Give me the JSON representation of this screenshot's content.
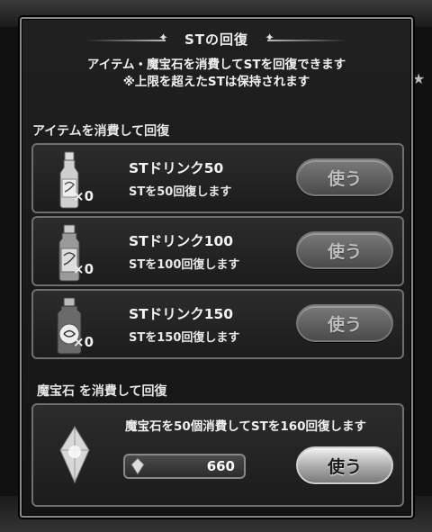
{
  "dialog": {
    "title": "STの回復",
    "description_line1": "アイテム・魔宝石を消費してSTを回復できます",
    "description_line2": "※上限を超えたSTは保持されます"
  },
  "items_section": {
    "label": "アイテムを消費して回復",
    "items": [
      {
        "name": "STドリンク50",
        "desc": "STを50回復します",
        "qty": "×0",
        "button": "使う"
      },
      {
        "name": "STドリンク100",
        "desc": "STを100回復します",
        "qty": "×0",
        "button": "使う"
      },
      {
        "name": "STドリンク150",
        "desc": "STを150回復します",
        "qty": "×0",
        "button": "使う"
      }
    ]
  },
  "gem_section": {
    "label": "魔宝石 を消費して回復",
    "desc": "魔宝石を50個消費してSTを160回復します",
    "count": "660",
    "button": "使う"
  },
  "icons": {
    "drink": "bottle-icon",
    "gem": "magic-gem-icon",
    "star": "star-icon"
  }
}
